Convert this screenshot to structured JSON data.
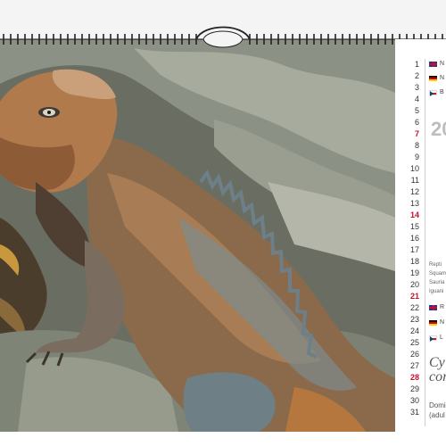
{
  "calendar": {
    "year_partial": "20",
    "days": [
      "1",
      "2",
      "3",
      "4",
      "5",
      "6",
      "7",
      "8",
      "9",
      "10",
      "11",
      "12",
      "13",
      "14",
      "15",
      "16",
      "17",
      "18",
      "19",
      "20",
      "21",
      "22",
      "23",
      "24",
      "25",
      "26",
      "27",
      "28",
      "29",
      "30",
      "31"
    ],
    "sunday_days": [
      "7",
      "14",
      "21",
      "28"
    ],
    "languages_top": [
      {
        "flag": "uk-flag-icon",
        "text": "N"
      },
      {
        "flag": "germany-flag-icon",
        "text": "N"
      },
      {
        "flag": "czech-flag-icon",
        "text": "B"
      }
    ],
    "taxonomy": [
      "Repti",
      "Squam",
      "Sauria",
      "Iguani"
    ],
    "languages_bottom": [
      {
        "flag": "uk-flag-icon",
        "text": "R"
      },
      {
        "flag": "germany-flag-icon",
        "text": "N"
      },
      {
        "flag": "czech-flag-icon",
        "text": "L"
      }
    ],
    "scientific_name_line1": "Cy",
    "scientific_name_line2": "cor",
    "note_line1": "Domi",
    "note_line2": "(adul"
  },
  "colors": {
    "sunday": "#c8102e",
    "binding": "#222222",
    "panel": "#ffffff"
  }
}
